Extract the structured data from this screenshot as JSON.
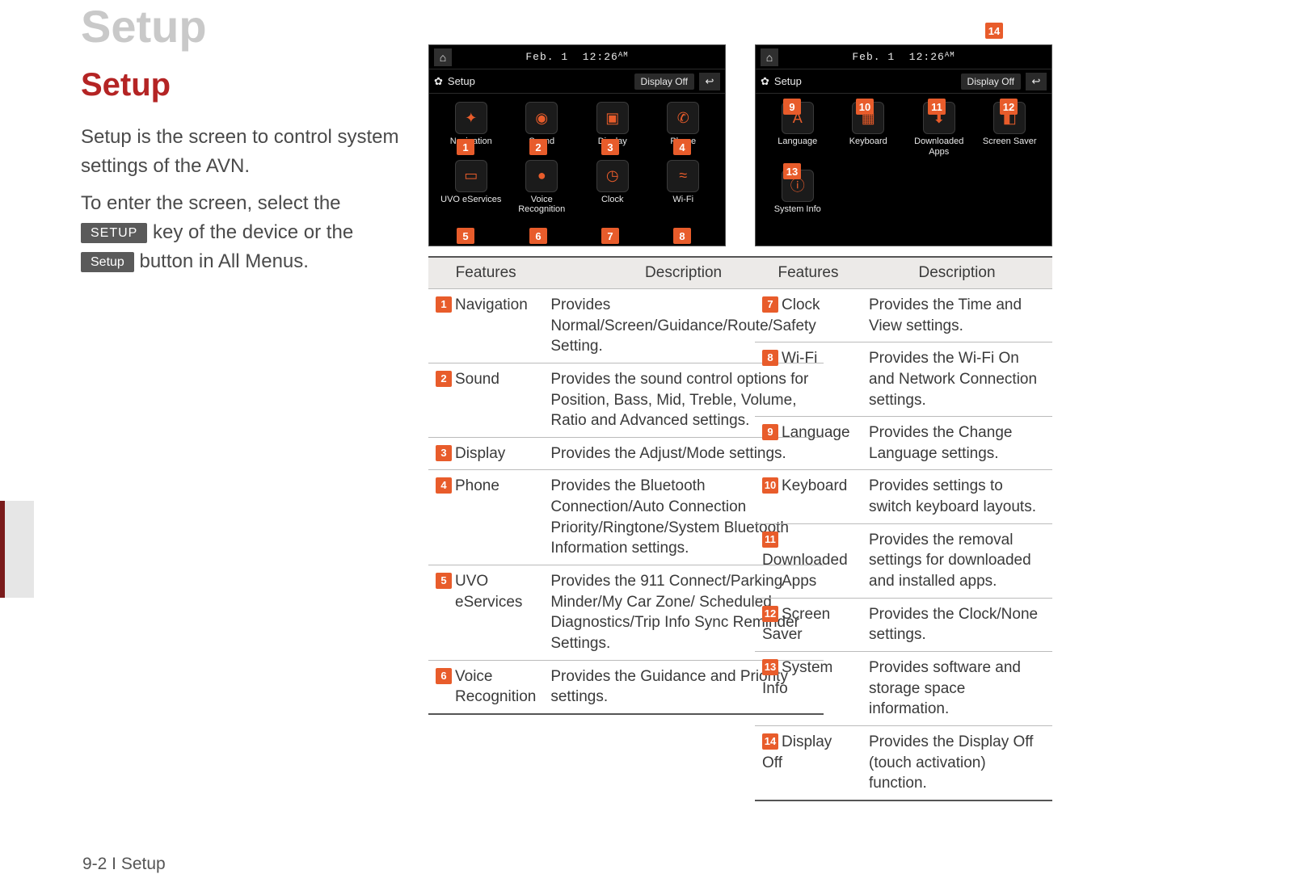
{
  "page": {
    "title_ghost": "Setup",
    "title_main": "Setup",
    "intro_line1": "Setup is the screen to control system settings of the AVN.",
    "intro_to_enter_a": "To enter the screen, select the ",
    "key_setup_upper": "SETUP",
    "intro_to_enter_b": " key of the device or the ",
    "key_setup_lower": "Setup",
    "intro_to_enter_c": " button in All Menus.",
    "footer": "9-2 I Setup"
  },
  "shot": {
    "date": "Feb. 1",
    "time": "12:26",
    "ampm": "AM",
    "menu_label": "Setup",
    "display_off": "Display Off",
    "apps_a": [
      "Navigation",
      "Sound",
      "Display",
      "Phone",
      "UVO eServices",
      "Voice\nRecognition",
      "Clock",
      "Wi-Fi"
    ],
    "apps_b": [
      "Language",
      "Keyboard",
      "Downloaded\nApps",
      "Screen Saver",
      "System Info"
    ]
  },
  "table_headers": {
    "features": "Features",
    "description": "Description"
  },
  "table_a": [
    {
      "n": "1",
      "name": "Navigation",
      "desc": "Provides Normal/Screen/Guidance/Route/Safety Setting."
    },
    {
      "n": "2",
      "name": "Sound",
      "desc": "Provides the sound control options for Position, Bass, Mid, Treble, Volume, Ratio and Advanced settings."
    },
    {
      "n": "3",
      "name": "Display",
      "desc": "Provides the Adjust/Mode settings."
    },
    {
      "n": "4",
      "name": "Phone",
      "desc": "Provides the Bluetooth Connection/Auto Connection Priority/Ringtone/System Bluetooth Information settings."
    },
    {
      "n": "5",
      "name": "UVO eServices",
      "desc": "Provides the 911 Connect/Parking Minder/My Car Zone/ Scheduled Diagnostics/Trip Info Sync Reminder Settings."
    },
    {
      "n": "6",
      "name": "Voice Recognition",
      "desc": "Provides the Guidance and Priority settings."
    }
  ],
  "table_b": [
    {
      "n": "7",
      "name": "Clock",
      "desc": "Provides the Time and View settings."
    },
    {
      "n": "8",
      "name": "Wi-Fi",
      "desc": "Provides the Wi-Fi On and Network Connection settings."
    },
    {
      "n": "9",
      "name": "Language",
      "desc": "Provides the Change Language settings."
    },
    {
      "n": "10",
      "name": "Keyboard",
      "desc": "Provides settings to switch keyboard layouts."
    },
    {
      "n": "11",
      "name": "Downloaded Apps",
      "desc": "Provides the removal settings for downloaded and installed apps."
    },
    {
      "n": "12",
      "name": "Screen Saver",
      "desc": "Provides the Clock/None settings."
    },
    {
      "n": "13",
      "name": "System Info",
      "desc": "Provides software and storage space information."
    },
    {
      "n": "14",
      "name": "Display Off",
      "desc": "Provides the Display Off (touch activation) function."
    }
  ]
}
